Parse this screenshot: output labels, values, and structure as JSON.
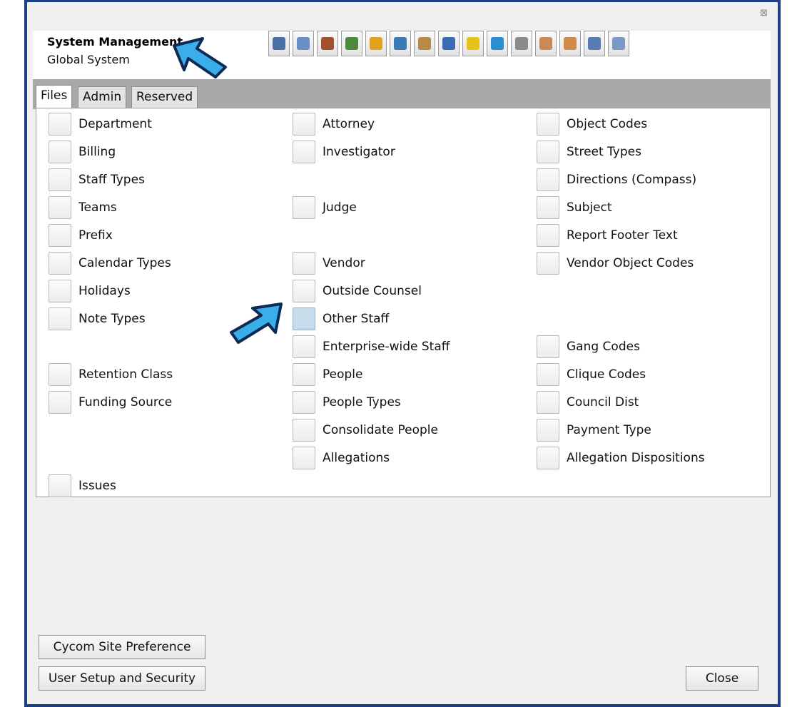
{
  "header": {
    "title": "System Management",
    "subtitle": "Global System"
  },
  "toolbar": {
    "icons": [
      {
        "name": "monitor-icon",
        "color": "#4a6fa5"
      },
      {
        "name": "document-icon",
        "color": "#6a8fc7"
      },
      {
        "name": "gavel-icon",
        "color": "#a0522d"
      },
      {
        "name": "book-icon",
        "color": "#4b8b3b"
      },
      {
        "name": "folder-icon",
        "color": "#e0a020"
      },
      {
        "name": "globe-icon",
        "color": "#3a7ab5"
      },
      {
        "name": "package-icon",
        "color": "#b88a4a"
      },
      {
        "name": "lock-icon",
        "color": "#3b6bb3"
      },
      {
        "name": "coins-icon",
        "color": "#e6c21a"
      },
      {
        "name": "user-upload-icon",
        "color": "#2a8fd0"
      },
      {
        "name": "car-icon",
        "color": "#8a8a8a"
      },
      {
        "name": "handshake-icon",
        "color": "#c98a5a"
      },
      {
        "name": "group-icon",
        "color": "#d08a4a"
      },
      {
        "name": "scroll-icon",
        "color": "#5a7ab5"
      },
      {
        "name": "magnifier-icon",
        "color": "#7a9ac5"
      }
    ]
  },
  "tabs": [
    "Files",
    "Admin",
    "Reserved"
  ],
  "items": {
    "col1": {
      "department": "Department",
      "billing": "Billing",
      "staff_types": "Staff Types",
      "teams": "Teams",
      "prefix": "Prefix",
      "calendar_types": "Calendar Types",
      "holidays": "Holidays",
      "note_types": "Note Types",
      "retention_class": "Retention Class",
      "funding_source": "Funding Source",
      "issues": "Issues"
    },
    "col2": {
      "attorney": "Attorney",
      "investigator": "Investigator",
      "judge": "Judge",
      "vendor": "Vendor",
      "outside_counsel": "Outside Counsel",
      "other_staff": "Other Staff",
      "enterprise_wide_staff": "Enterprise-wide Staff",
      "people": "People",
      "people_types": "People Types",
      "consolidate_people": "Consolidate People",
      "allegations": "Allegations"
    },
    "col3": {
      "object_codes": "Object Codes",
      "street_types": "Street Types",
      "directions": "Directions (Compass)",
      "subject": "Subject",
      "report_footer_text": "Report Footer Text",
      "vendor_object_codes": "Vendor Object Codes",
      "gang_codes": "Gang Codes",
      "clique_codes": "Clique Codes",
      "council_dist": "Council Dist",
      "payment_type": "Payment Type",
      "allegation_dispositions": "Allegation Dispositions"
    }
  },
  "buttons": {
    "site_preference": "Cycom Site Preference",
    "user_setup": "User Setup and Security",
    "close": "Close"
  },
  "window": {
    "close_glyph": "⊠"
  },
  "colors": {
    "frame": "#1e3f7f",
    "arrow_fill": "#3aaee8",
    "highlight": "#c6dceb"
  }
}
